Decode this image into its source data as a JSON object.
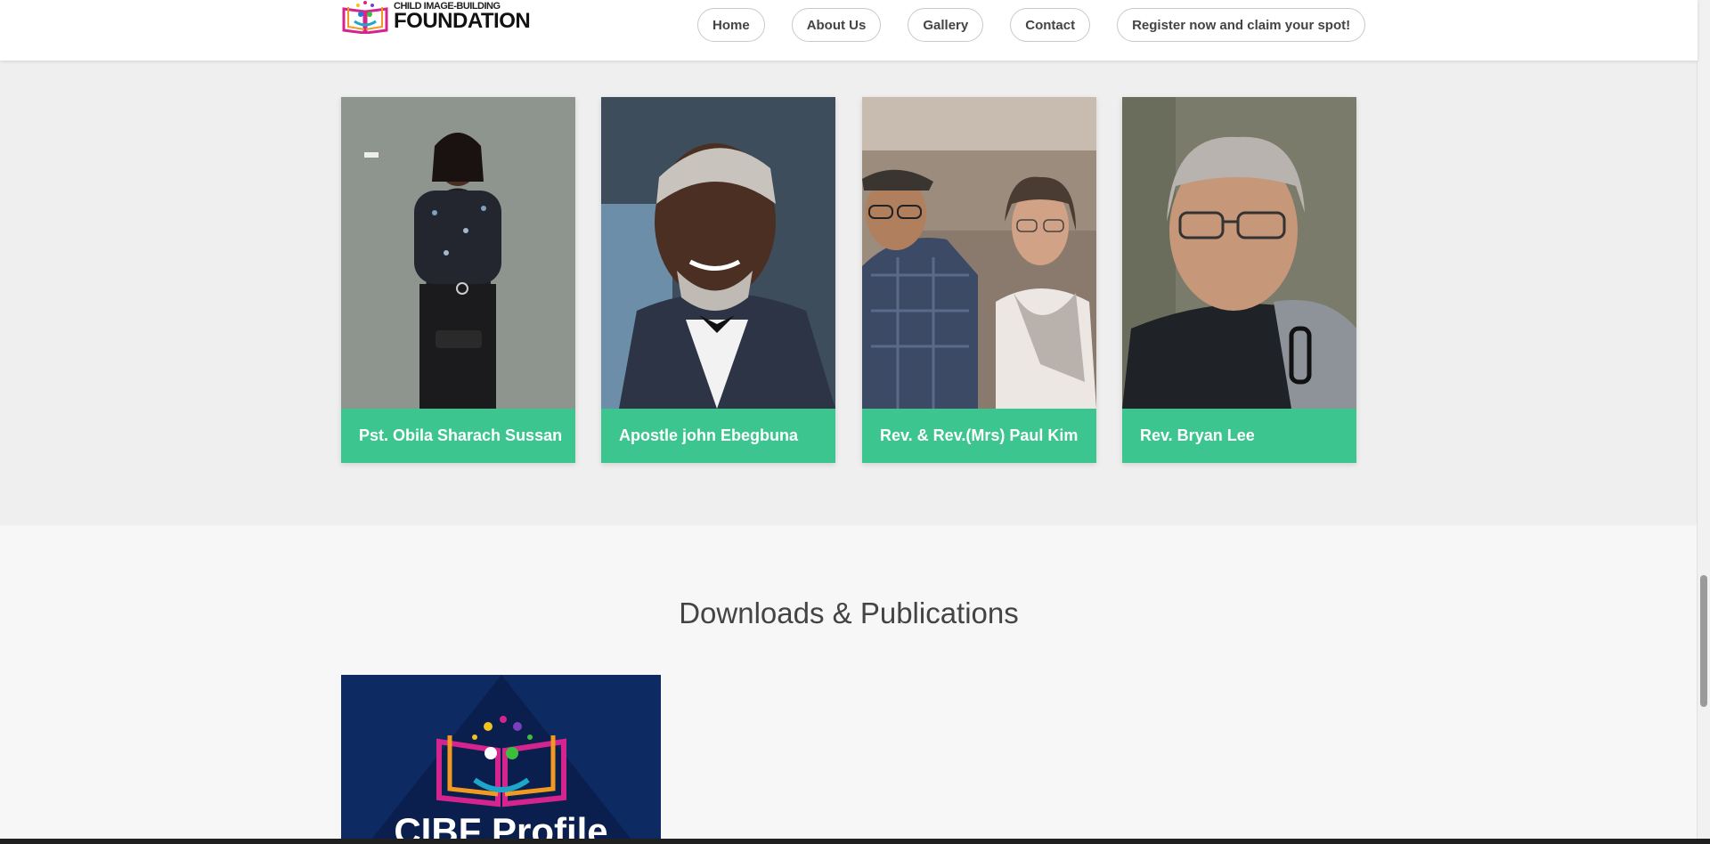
{
  "header": {
    "logo_small": "CHILD IMAGE-BUILDING",
    "logo_big": "FOUNDATION",
    "nav": [
      {
        "label": "Home"
      },
      {
        "label": "About Us"
      },
      {
        "label": "Gallery"
      },
      {
        "label": "Contact"
      },
      {
        "label": "Register now and claim your spot!"
      }
    ]
  },
  "team": [
    {
      "name": "Pst. Obila Sharach Sussan"
    },
    {
      "name": "Apostle john Ebegbuna"
    },
    {
      "name": "Rev. & Rev.(Mrs) Paul Kim"
    },
    {
      "name": "Rev. Bryan Lee"
    }
  ],
  "downloads": {
    "title": "Downloads & Publications",
    "publication_label": "CIBF Profile"
  },
  "colors": {
    "accent_green": "#3cc58e",
    "publication_bg": "#0d2a63"
  }
}
